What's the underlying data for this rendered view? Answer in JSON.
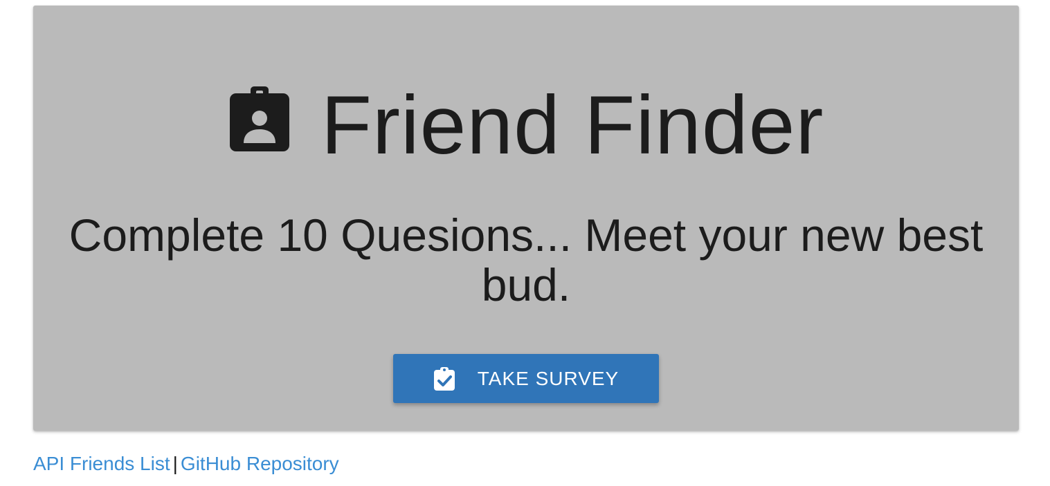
{
  "header": {
    "title": "Friend Finder",
    "title_icon": "badge-person-icon",
    "subtitle": "Complete 10 Quesions... Meet your new best bud."
  },
  "cta": {
    "label": "TAKE SURVEY",
    "icon": "clipboard-check-icon"
  },
  "footer": {
    "links": [
      {
        "label": "API Friends List"
      },
      {
        "label": "GitHub Repository"
      }
    ],
    "separator": "|"
  },
  "colors": {
    "jumbotron_bg": "#bababa",
    "button_bg": "#3075b8",
    "link": "#3a8dd4",
    "text": "#1c1c1c"
  }
}
